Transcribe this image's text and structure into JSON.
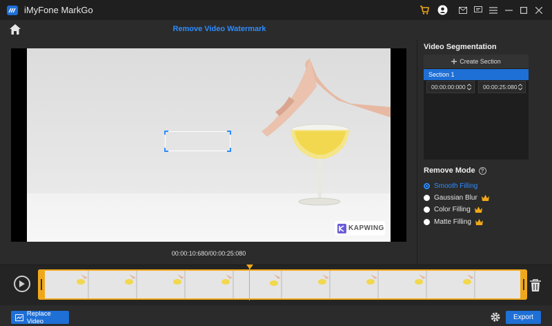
{
  "app": {
    "title": "iMyFone MarkGo"
  },
  "header": {
    "page_title": "Remove Video Watermark"
  },
  "preview": {
    "watermark_text": "KAPWING",
    "timecode": "00:00:10:680/00:00:25:080"
  },
  "segmentation": {
    "title": "Video Segmentation",
    "create_label": "Create Section",
    "sections": [
      {
        "label": "Section 1",
        "start": "00:00:00:000",
        "end": "00:00:25:080"
      }
    ]
  },
  "remove_mode": {
    "title": "Remove Mode",
    "options": [
      {
        "label": "Smooth Filling",
        "selected": true,
        "premium": false
      },
      {
        "label": "Gaussian Blur",
        "selected": false,
        "premium": true
      },
      {
        "label": "Color Filling",
        "selected": false,
        "premium": true
      },
      {
        "label": "Matte Filling",
        "selected": false,
        "premium": true
      }
    ]
  },
  "timeline": {
    "playhead_fraction": 0.43
  },
  "footer": {
    "replace_label": "Replace Video",
    "export_label": "Export"
  },
  "colors": {
    "accent": "#1e6fd6",
    "link": "#2d8cff",
    "timeline": "#f0a81a",
    "premium": "#f0a81a"
  }
}
